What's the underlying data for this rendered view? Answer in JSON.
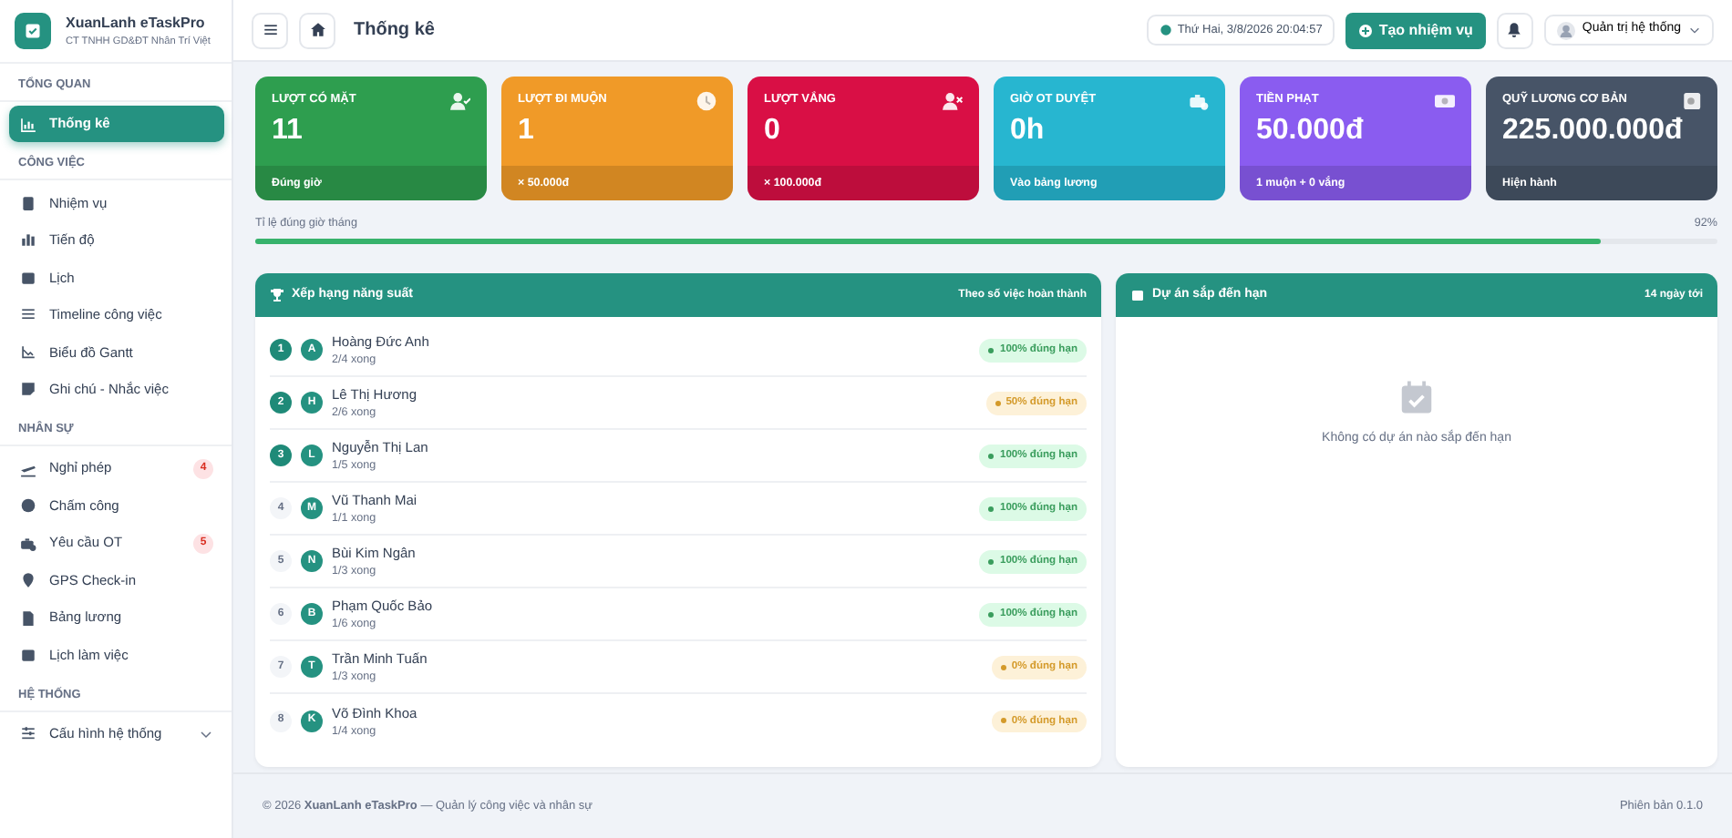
{
  "brand": {
    "name": "XuanLanh eTaskPro",
    "subtitle": "CT TNHH GD&ĐT Nhân Trí Việt"
  },
  "sidebar": {
    "sections": [
      {
        "title": "TỔNG QUAN",
        "items": [
          {
            "label": "Thống kê",
            "selected": true
          }
        ]
      },
      {
        "title": "CÔNG VIỆC",
        "items": [
          {
            "label": "Nhiệm vụ",
            "selected": false
          },
          {
            "label": "Tiến độ",
            "selected": false
          },
          {
            "label": "Lịch",
            "selected": false
          },
          {
            "label": "Timeline công việc",
            "selected": false
          },
          {
            "label": "Biểu đồ Gantt",
            "selected": false
          },
          {
            "label": "Ghi chú - Nhắc việc",
            "selected": false
          }
        ]
      },
      {
        "title": "NHÂN SỰ",
        "items": [
          {
            "label": "Nghỉ phép",
            "selected": false,
            "badge": "4"
          },
          {
            "label": "Chấm công",
            "selected": false
          },
          {
            "label": "Yêu cầu OT",
            "selected": false,
            "badge": "5"
          },
          {
            "label": "GPS Check-in",
            "selected": false
          },
          {
            "label": "Bảng lương",
            "selected": false
          },
          {
            "label": "Lịch làm việc",
            "selected": false
          }
        ]
      },
      {
        "title": "HỆ THỐNG",
        "items": [
          {
            "label": "Cấu hình hệ thống",
            "selected": false,
            "expandable": true
          }
        ]
      }
    ]
  },
  "topbar": {
    "title": "Thống kê",
    "datetime": "Thứ Hai, 3/8/2026 20:04:57",
    "create_button": "Tạo nhiệm vụ",
    "user": "Quản trị hệ thống"
  },
  "stats": [
    {
      "label": "LƯỢT CÓ MẶT",
      "value": "11",
      "footer": "Đúng giờ",
      "color": "#2e9e4f"
    },
    {
      "label": "LƯỢT ĐI MUỘN",
      "value": "1",
      "footer": "× 50.000đ",
      "color": "#f09a28"
    },
    {
      "label": "LƯỢT VẮNG",
      "value": "0",
      "footer": "× 100.000đ",
      "color": "#d90f45"
    },
    {
      "label": "GIỜ OT DUYỆT",
      "value": "0h",
      "footer": "Vào bảng lương",
      "color": "#27b6d0"
    },
    {
      "label": "TIỀN PHẠT",
      "value": "50.000đ",
      "footer": "1 muộn + 0 vắng",
      "color": "#8a5cf0"
    },
    {
      "label": "QUỸ LƯƠNG CƠ BẢN",
      "value": "225.000.000đ",
      "footer": "Hiện hành",
      "color": "#475467"
    }
  ],
  "punctuality": {
    "label": "Tỉ lệ đúng giờ tháng",
    "reading": "92%",
    "level": 0.92
  },
  "ranking": {
    "title": "Xếp hạng năng suất",
    "subtitle": "Theo số việc hoàn thành",
    "rows": [
      {
        "rank": "1",
        "initial": "A",
        "name": "Hoàng Đức Anh",
        "done": "2/4 xong",
        "badge": "100% đúng hạn",
        "kind": "good",
        "top": true
      },
      {
        "rank": "2",
        "initial": "H",
        "name": "Lê Thị Hương",
        "done": "2/6 xong",
        "badge": "50% đúng hạn",
        "kind": "warning",
        "top": true
      },
      {
        "rank": "3",
        "initial": "L",
        "name": "Nguyễn Thị Lan",
        "done": "1/5 xong",
        "badge": "100% đúng hạn",
        "kind": "good",
        "top": true
      },
      {
        "rank": "4",
        "initial": "M",
        "name": "Vũ Thanh Mai",
        "done": "1/1 xong",
        "badge": "100% đúng hạn",
        "kind": "good",
        "top": false
      },
      {
        "rank": "5",
        "initial": "N",
        "name": "Bùi Kim Ngân",
        "done": "1/3 xong",
        "badge": "100% đúng hạn",
        "kind": "good",
        "top": false
      },
      {
        "rank": "6",
        "initial": "B",
        "name": "Phạm Quốc Bảo",
        "done": "1/6 xong",
        "badge": "100% đúng hạn",
        "kind": "good",
        "top": false
      },
      {
        "rank": "7",
        "initial": "T",
        "name": "Trần Minh Tuấn",
        "done": "1/3 xong",
        "badge": "0% đúng hạn",
        "kind": "warning",
        "top": false
      },
      {
        "rank": "8",
        "initial": "K",
        "name": "Võ Đình Khoa",
        "done": "1/4 xong",
        "badge": "0% đúng hạn",
        "kind": "warning",
        "top": false
      }
    ]
  },
  "projects": {
    "title": "Dự án sắp đến hạn",
    "subtitle": "14 ngày tới",
    "empty_text": "Không có dự án nào sắp đến hạn"
  },
  "footer": {
    "copyright": "© 2026 **XuanLanh eTaskPro** — Quản lý công việc và nhân sự",
    "version": "Phiên bản 0.1.0"
  }
}
